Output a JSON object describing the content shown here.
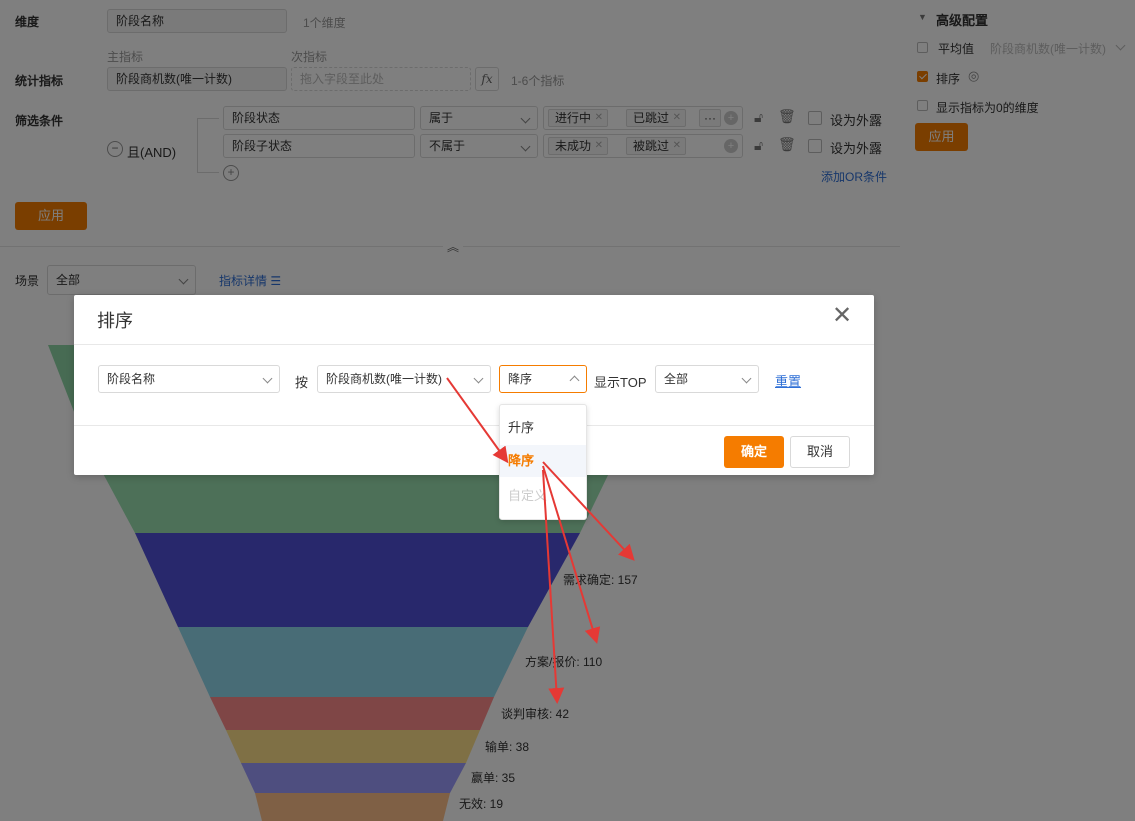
{
  "config": {
    "dimension_label": "维度",
    "dimension_value": "阶段名称",
    "dimension_count": "1个维度",
    "primary_metric_caption": "主指标",
    "secondary_metric_caption": "次指标",
    "metric_label": "统计指标",
    "primary_metric_value": "阶段商机数(唯一计数)",
    "secondary_placeholder": "拖入字段至此处",
    "fx_label": "fx",
    "metric_count": "1-6个指标",
    "filter_label": "筛选条件",
    "and_label": "且(AND)",
    "filters": [
      {
        "field": "阶段状态",
        "op": "属于",
        "tags": [
          "进行中",
          "已跳过"
        ],
        "more": "···",
        "expose": "设为外露"
      },
      {
        "field": "阶段子状态",
        "op": "不属于",
        "tags": [
          "未成功",
          "被跳过"
        ],
        "expose": "设为外露"
      }
    ],
    "add_or_label": "添加OR条件",
    "apply_label": "应用"
  },
  "advanced": {
    "title": "高级配置",
    "avg_label": "平均值",
    "avg_select": "阶段商机数(唯一计数)",
    "sort_label": "排序",
    "show_zero_label": "显示指标为0的维度",
    "apply_label": "应用"
  },
  "scene": {
    "label": "场景",
    "value": "全部",
    "detail_link": "指标详情"
  },
  "funnel": {
    "labels": [
      "需求确定: 157",
      "方案/报价: 110",
      "谈判审核: 42",
      "输单: 38",
      "赢单: 35",
      "无效: 19"
    ]
  },
  "modal": {
    "title": "排序",
    "field_value": "阶段名称",
    "by_label": "按",
    "metric_value": "阶段商机数(唯一计数)",
    "order_value": "降序",
    "top_label": "显示TOP",
    "top_value": "全部",
    "reset_label": "重置",
    "confirm_label": "确定",
    "cancel_label": "取消",
    "options": [
      "升序",
      "降序",
      "自定义"
    ]
  },
  "colors": {
    "accent": "#f57c00",
    "link": "#2f6fd6",
    "arrow": "#e53935",
    "funnel": [
      "#8fd6a6",
      "#9ae0b0",
      "#5151d8",
      "#91d8ec",
      "#ff8c8c",
      "#ffe08a",
      "#9d9dff",
      "#ffc08a"
    ]
  }
}
